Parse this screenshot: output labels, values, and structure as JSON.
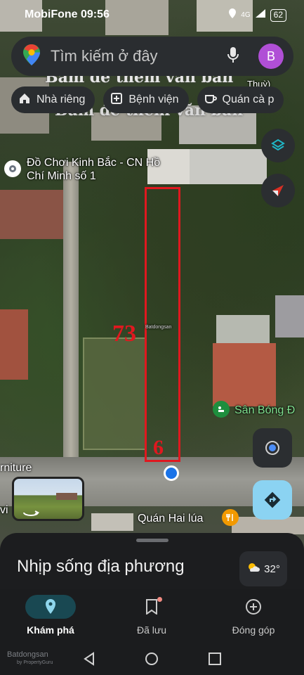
{
  "status_bar": {
    "carrier": "MobiFone",
    "time": "09:56",
    "network": "4G",
    "battery": "62"
  },
  "search": {
    "placeholder": "Tìm kiếm ở đây",
    "avatar_initial": "B"
  },
  "chips": [
    {
      "label": "Nhà riêng",
      "icon": "home-icon"
    },
    {
      "label": "Bệnh viện",
      "icon": "hospital-icon"
    },
    {
      "label": "Quán cà p",
      "icon": "coffee-icon"
    }
  ],
  "overlay_texts": [
    "Bấm để thêm văn bản",
    "Bấm để thêm văn bản"
  ],
  "partial_map_label": "Thuỳ)",
  "map_places": {
    "toy_store": "Đồ Chơi Kinh Bắc - CN Hồ Chí Minh số 1",
    "stadium": "Sân Bóng Đ",
    "restaurant": "Quán Hai lúa",
    "furniture": "rniture",
    "left_edge": "vi"
  },
  "plot_annotations": {
    "length": "73",
    "width": "6"
  },
  "map_watermark": "Batdongsan",
  "bottom_sheet": {
    "title": "Nhịp sống địa phương",
    "temperature": "32°"
  },
  "bottom_nav": [
    {
      "label": "Khám phá",
      "icon": "location-pin-icon",
      "active": true
    },
    {
      "label": "Đã lưu",
      "icon": "bookmark-icon",
      "active": false
    },
    {
      "label": "Đóng góp",
      "icon": "add-circle-icon",
      "active": false
    }
  ],
  "footer_watermark": {
    "brand": "Batdongsan",
    "by": "by PropertyGuru"
  },
  "colors": {
    "accent": "#1a73e8",
    "plot_outline": "#e0181f",
    "avatar": "#b04fd6"
  }
}
